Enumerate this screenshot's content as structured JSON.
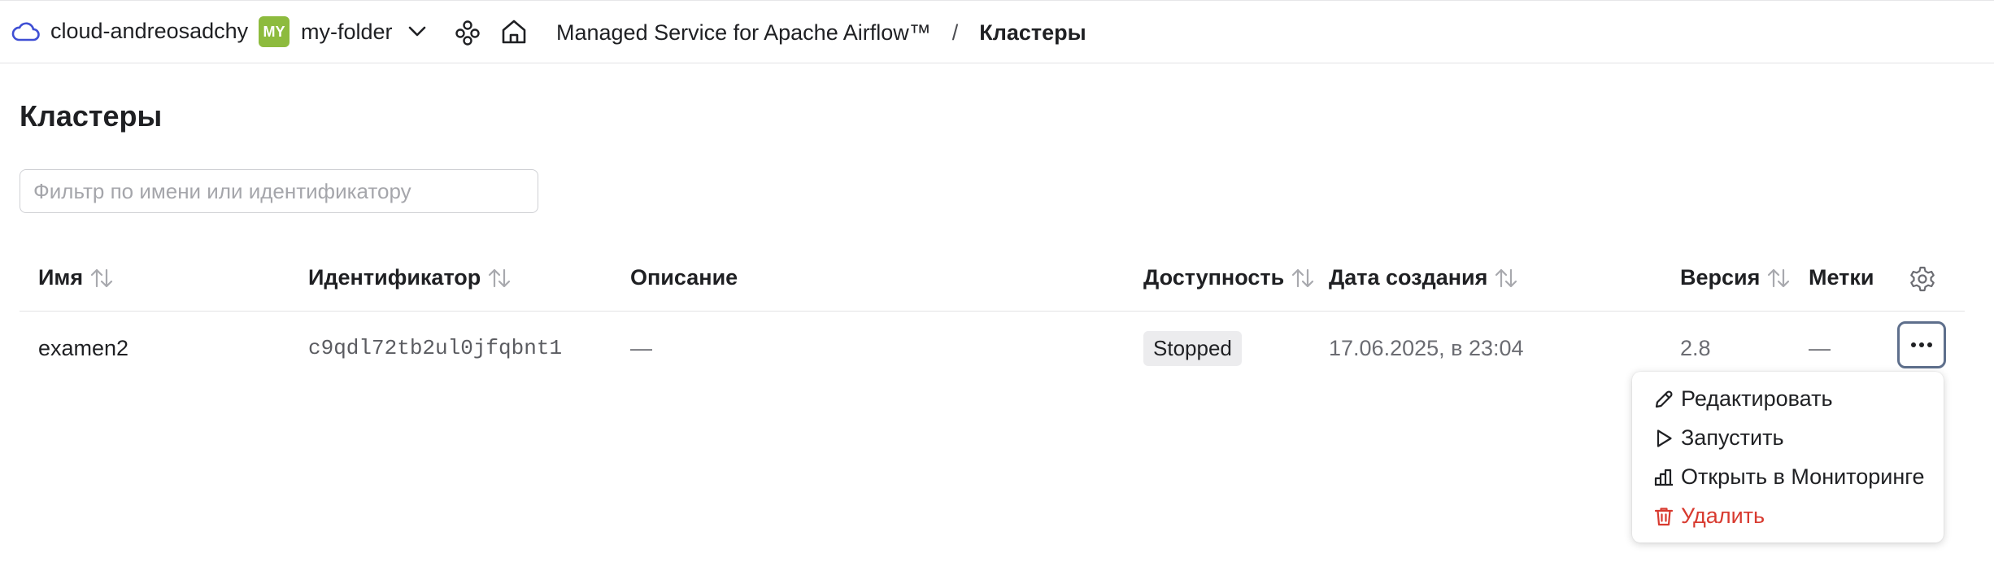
{
  "topbar": {
    "cloud_name": "cloud-andreosadchy",
    "folder_avatar": "MY",
    "folder_name": "my-folder",
    "service_name": "Managed Service for Apache Airflow™",
    "separator": "/",
    "current_page": "Кластеры"
  },
  "page": {
    "title": "Кластеры",
    "filter_placeholder": "Фильтр по имени или идентификатору"
  },
  "table": {
    "columns": {
      "name": "Имя",
      "id": "Идентификатор",
      "description": "Описание",
      "availability": "Доступность",
      "created": "Дата создания",
      "version": "Версия",
      "labels": "Метки"
    },
    "rows": [
      {
        "name": "examen2",
        "id": "c9qdl72tb2ul0jfqbnt1",
        "description": "—",
        "status": "Stopped",
        "created": "17.06.2025, в 23:04",
        "version": "2.8",
        "labels": "—"
      }
    ]
  },
  "menu": {
    "items": [
      {
        "label": "Редактировать",
        "icon": "pencil-icon"
      },
      {
        "label": "Запустить",
        "icon": "play-icon"
      },
      {
        "label": "Открыть в Мониторинге",
        "icon": "chart-icon"
      },
      {
        "label": "Удалить",
        "icon": "trash-icon"
      }
    ]
  },
  "colors": {
    "accent_icon": "#3f4fd4",
    "avatar_bg": "#8dbb3e",
    "danger": "#d83a2f",
    "status_badge_bg": "#ececee"
  }
}
